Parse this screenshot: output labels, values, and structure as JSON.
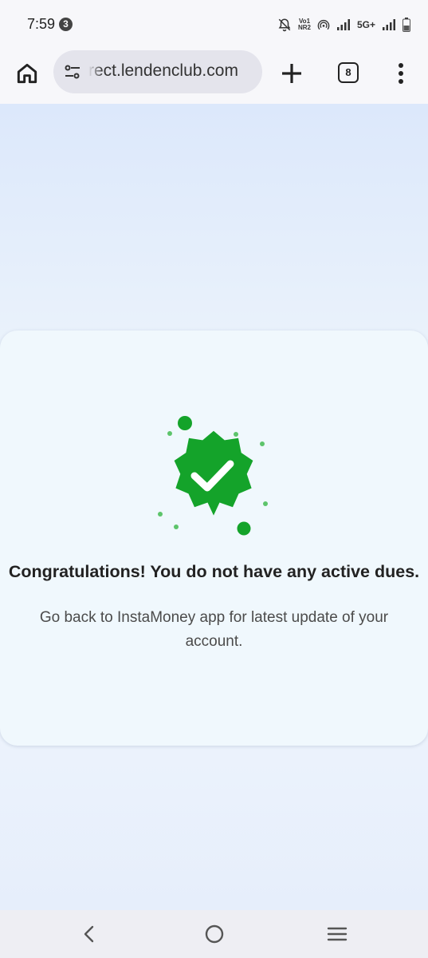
{
  "status_bar": {
    "time": "7:59",
    "notification_count": "3",
    "volte_top": "Vo1",
    "volte_bottom": "NR2",
    "network_type": "5G+",
    "icons": [
      "mute-icon",
      "volte-icon",
      "hotspot-icon",
      "signal-icon",
      "signal-icon",
      "battery-icon"
    ]
  },
  "browser": {
    "url": "rect.lendenclub.com",
    "tab_count": "8",
    "icons": [
      "home-icon",
      "site-settings-icon",
      "plus-icon",
      "more-vert-icon"
    ]
  },
  "content": {
    "title": "Congratulations! You do not have any active dues.",
    "subtitle": "Go back to InstaMoney app for latest update of your account.",
    "badge_color": "#14a32a",
    "badge_icon": "verified-check-icon"
  },
  "navigation": {
    "icons": [
      "back-icon",
      "home-circle-icon",
      "recents-icon"
    ]
  },
  "colors": {
    "accent_green": "#14a32a",
    "background_blue": "#dce8fb",
    "card_bg": "#f0f8fd"
  }
}
